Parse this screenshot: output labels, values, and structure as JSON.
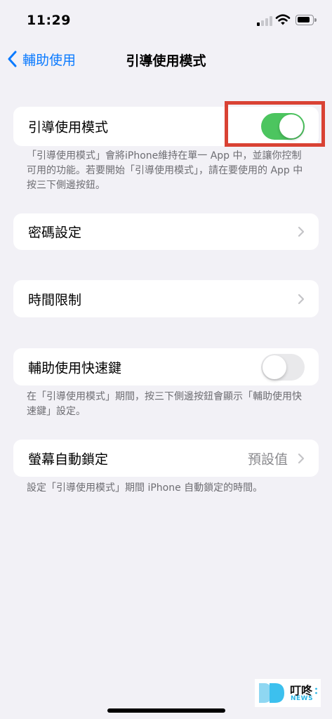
{
  "status_bar": {
    "time": "11:29"
  },
  "nav": {
    "back_label": "輔助使用",
    "title": "引導使用模式"
  },
  "guided_access": {
    "label": "引導使用模式",
    "enabled": true
  },
  "guided_access_note": "「引導使用模式」會將iPhone維持在單一 App 中，並讓你控制可用的功能。若要開始「引導使用模式」，請在要使用的 App 中按三下側邊按鈕。",
  "passcode_settings": {
    "label": "密碼設定"
  },
  "time_limits": {
    "label": "時間限制"
  },
  "accessibility_shortcut": {
    "label": "輔助使用快速鍵",
    "enabled": false
  },
  "shortcut_note": "在「引導使用模式」期間，按三下側邊按鈕會顯示「輔助使用快速鍵」設定。",
  "auto_lock": {
    "label": "螢幕自動鎖定",
    "value": "預設值"
  },
  "auto_lock_note": "設定「引導使用模式」期間 iPhone 自動鎖定的時間。",
  "watermark": {
    "name": "叮咚",
    "sub": "NEWS"
  },
  "colors": {
    "accent": "#0a7aff",
    "toggle_on": "#4cc55f",
    "highlight": "#d94234",
    "background": "#f2f1f6"
  }
}
